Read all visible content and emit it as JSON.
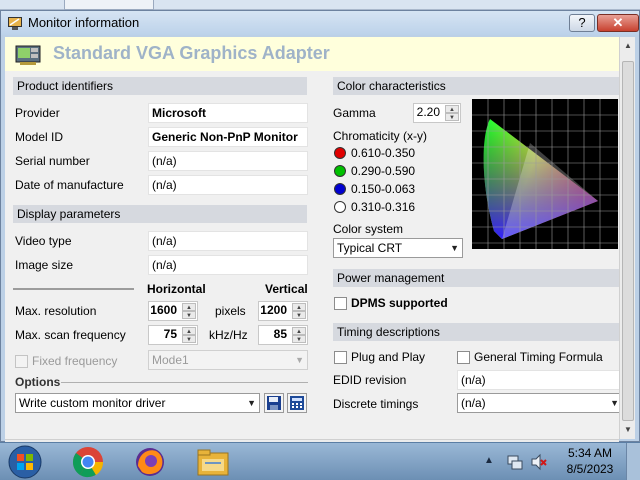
{
  "window": {
    "title": "Monitor information",
    "help_label": "?",
    "close_label": "✕"
  },
  "header": {
    "adapter_name": "Standard VGA Graphics Adapter"
  },
  "product_identifiers": {
    "heading": "Product identifiers",
    "provider_label": "Provider",
    "provider_value": "Microsoft",
    "model_label": "Model ID",
    "model_value": "Generic Non-PnP Monitor",
    "serial_label": "Serial number",
    "serial_value": "(n/a)",
    "date_label": "Date of manufacture",
    "date_value": "(n/a)"
  },
  "display_parameters": {
    "heading": "Display parameters",
    "video_type_label": "Video type",
    "video_type_value": "(n/a)",
    "image_size_label": "Image size",
    "image_size_value": "(n/a)",
    "horizontal_label": "Horizontal",
    "vertical_label": "Vertical",
    "max_res_label": "Max. resolution",
    "max_res_h": "1600",
    "pixels_label": "pixels",
    "max_res_v": "1200",
    "scan_label": "Max. scan frequency",
    "scan_h": "75",
    "scan_unit": "kHz/Hz",
    "scan_v": "85",
    "fixed_freq_label": "Fixed frequency",
    "fixed_freq_value": "Mode1"
  },
  "options": {
    "heading": "Options",
    "action_value": "Write custom monitor driver"
  },
  "color": {
    "heading": "Color characteristics",
    "gamma_label": "Gamma",
    "gamma_value": "2.20",
    "chromaticity_label": "Chromaticity (x-y)",
    "points": [
      {
        "color": "#e00000",
        "value": "0.610-0.350"
      },
      {
        "color": "#00c000",
        "value": "0.290-0.590"
      },
      {
        "color": "#0000d0",
        "value": "0.150-0.063"
      },
      {
        "color": "#ffffff",
        "value": "0.310-0.316"
      }
    ],
    "color_system_label": "Color system",
    "color_system_value": "Typical CRT"
  },
  "power": {
    "heading": "Power management",
    "dpms_label": "DPMS supported"
  },
  "timing": {
    "heading": "Timing descriptions",
    "plug_play_label": "Plug and Play",
    "gtf_label": "General Timing Formula",
    "edid_label": "EDID revision",
    "edid_value": "(n/a)",
    "discrete_label": "Discrete timings",
    "discrete_value": "(n/a)"
  },
  "taskbar": {
    "time": "5:34 AM",
    "date": "8/5/2023",
    "pinned_icons": [
      "start-orb-icon",
      "chrome-icon",
      "firefox-icon",
      "file-explorer-icon"
    ],
    "tray_icons": [
      "tray-expand-icon",
      "network-icon",
      "volume-muted-icon"
    ]
  }
}
